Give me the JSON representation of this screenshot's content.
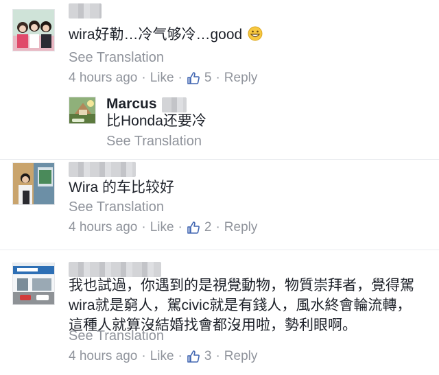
{
  "comments": [
    {
      "text": "wira好勒…冷气够冷…good",
      "see_translation": "See Translation",
      "time": "4 hours ago",
      "like": "Like",
      "likes": "5",
      "reply": "Reply",
      "reply_comment": {
        "name": "Marcus",
        "text": "比Honda还要冷",
        "see_translation": "See Translation"
      }
    },
    {
      "text": "Wira 的车比较好",
      "see_translation": "See Translation",
      "time": "4 hours ago",
      "like": "Like",
      "likes": "2",
      "reply": "Reply"
    },
    {
      "text_lines": [
        "我也試過，你遇到的是視覺動物，物質崇拜者，覺得駕",
        "wira就是窮人，駕civic就是有錢人，風水終會輪流轉，",
        "這種人就算沒結婚找會都沒用啦，勢利眼啊。"
      ],
      "see_translation": "See Translation",
      "time": "4 hours ago",
      "like": "Like",
      "likes": "3",
      "reply": "Reply"
    }
  ],
  "separator": "·",
  "colors": {
    "text": "#1d2129",
    "meta": "#90949c",
    "like_icon": "#4267b2"
  }
}
